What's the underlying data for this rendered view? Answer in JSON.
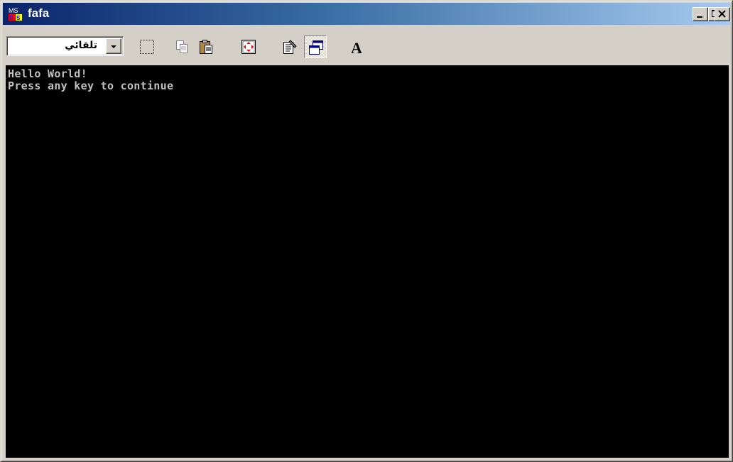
{
  "window": {
    "title": "fafa",
    "icon": "ms-dos-icon"
  },
  "titlebar_buttons": {
    "minimize": "minimize-icon",
    "maximize": "maximize-icon",
    "close": "close-icon"
  },
  "toolbar": {
    "font_select_value": "تلقائي",
    "tools": [
      "mark-icon",
      "copy-icon",
      "paste-icon",
      "full-screen-icon",
      "properties-icon",
      "background-icon",
      "font-icon"
    ],
    "font_button_label": "A"
  },
  "console": {
    "lines": [
      "Hello World!",
      "Press any key to continue"
    ]
  },
  "colors": {
    "title_gradient_start": "#0a246a",
    "title_gradient_end": "#a6caf0",
    "console_bg": "#000000",
    "console_text": "#c0c0c0",
    "chrome": "#d4d0c8"
  }
}
